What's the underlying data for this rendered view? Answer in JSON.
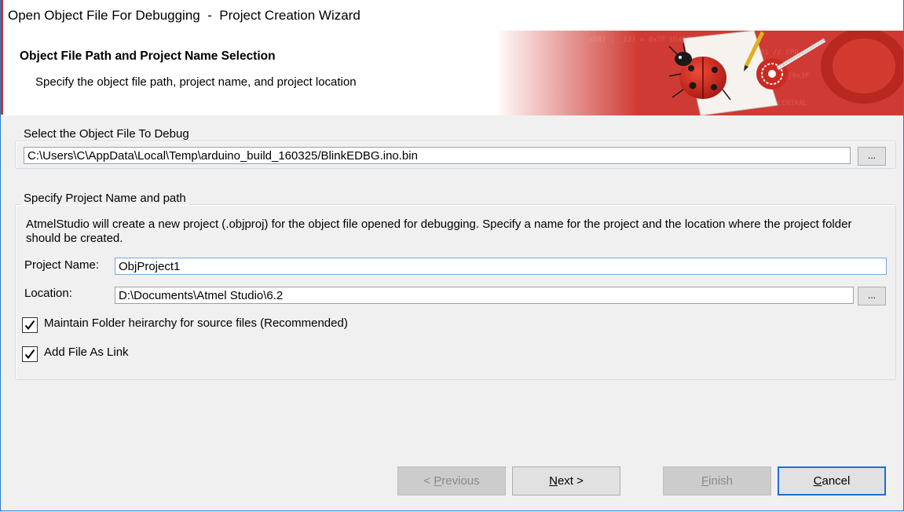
{
  "window": {
    "title": "Open Object File For Debugging  -  Project Creation Wizard"
  },
  "header": {
    "heading": "Object File Path and Project Name Selection",
    "subheading": "Specify the object file path, project name, and project location"
  },
  "object_file_group": {
    "legend": "Select the Object File To Debug",
    "path_value": "C:\\Users\\C\\AppData\\Local\\Temp\\arduino_build_160325/BlinkEDBG.ino.bin",
    "browse_label": "..."
  },
  "project_group": {
    "legend": "Specify Project Name and path",
    "description": "AtmelStudio will create a new project (.objproj) for the object file opened for debugging. Specify a name for the project and the location where the project folder should be created.",
    "name_label": "Project Name:",
    "name_value": "ObjProject1",
    "location_label": "Location:",
    "location_value": "D:\\Documents\\Atmel Studio\\6.2",
    "browse_label": "...",
    "options": [
      {
        "label": "Maintain Folder heirarchy for source files (Recommended)",
        "checked": true
      },
      {
        "label": "Add File As Link",
        "checked": true
      }
    ]
  },
  "buttons": {
    "previous": {
      "prefix": "< ",
      "mnemonic": "P",
      "rest": "revious",
      "enabled": false
    },
    "next": {
      "mnemonic": "N",
      "rest": "ext >",
      "enabled": true
    },
    "finish": {
      "mnemonic": "F",
      "rest": "inish",
      "enabled": false
    },
    "cancel": {
      "mnemonic": "C",
      "rest": "ancel",
      "enabled": true
    }
  },
  "colors": {
    "accent_red": "#c8342b",
    "window_border": "#2b79c8",
    "default_button_border": "#1d6fd4"
  },
  "icons": {
    "banner_art": "ladybug-illustration",
    "check": "check-mark-icon"
  }
}
